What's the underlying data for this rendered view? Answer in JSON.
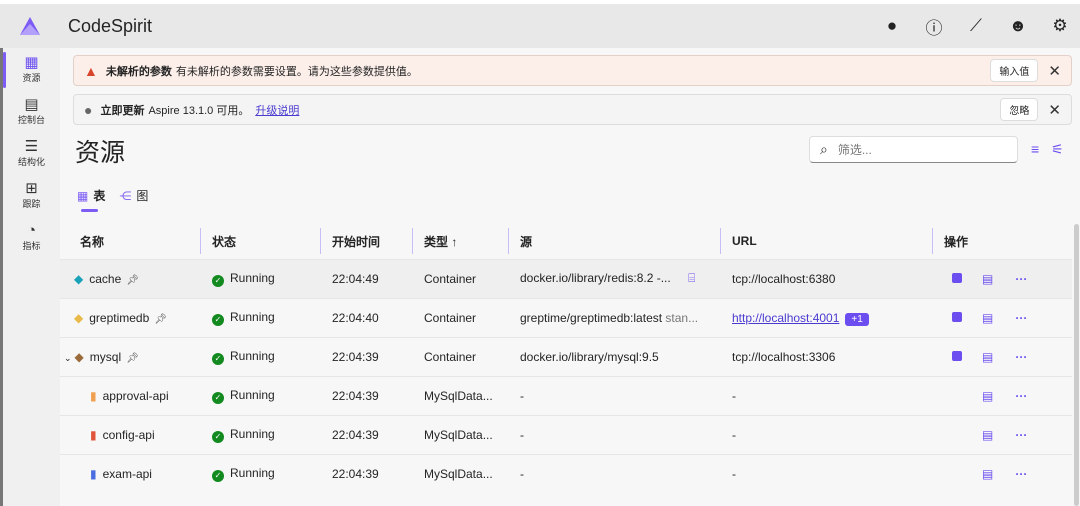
{
  "app": {
    "title": "CodeSpirit"
  },
  "sidebar": {
    "items": [
      {
        "label": "资源",
        "icon": "▦"
      },
      {
        "label": "控制台",
        "icon": "▤"
      },
      {
        "label": "结构化",
        "icon": "☰"
      },
      {
        "label": "跟踪",
        "icon": "⊞"
      },
      {
        "label": "指标",
        "icon": "◔"
      }
    ]
  },
  "banners": {
    "warning": {
      "title": "未解析的参数",
      "text": "有未解析的参数需要设置。请为这些参数提供值。",
      "button": "输入值"
    },
    "update": {
      "title": "立即更新",
      "text": "Aspire 13.1.0 可用。",
      "link": "升级说明",
      "button": "忽略"
    }
  },
  "page": {
    "title": "资源",
    "filter_placeholder": "筛选..."
  },
  "tabs": [
    {
      "label": "表"
    },
    {
      "label": "图"
    }
  ],
  "table": {
    "headers": [
      "名称",
      "状态",
      "开始时间",
      "类型 ↑",
      "源",
      "URL",
      "操作"
    ],
    "rows": [
      {
        "name": "cache",
        "icon": "◆",
        "icon_color": "#1aa3b8",
        "pinned": true,
        "status": "Running",
        "start": "22:04:49",
        "type": "Container",
        "source": "docker.io/library/redis:8.2 -...",
        "source_extra": "",
        "url": "tcp://localhost:6380",
        "url_link": false,
        "url_extra": "",
        "stop": true
      },
      {
        "name": "greptimedb",
        "icon": "◆",
        "icon_color": "#e9b94a",
        "pinned": true,
        "status": "Running",
        "start": "22:04:40",
        "type": "Container",
        "source": "greptime/greptimedb:latest",
        "source_extra": "stan...",
        "url": "http://localhost:4001",
        "url_link": true,
        "url_extra": "+1",
        "stop": true
      },
      {
        "name": "mysql",
        "icon": "◆",
        "icon_color": "#9a6a3a",
        "pinned": true,
        "status": "Running",
        "start": "22:04:39",
        "type": "Container",
        "source": "docker.io/library/mysql:9.5",
        "source_extra": "",
        "url": "tcp://localhost:3306",
        "url_link": false,
        "url_extra": "",
        "stop": true
      },
      {
        "name": "approval-api",
        "icon": "▮",
        "icon_color": "#f0a050",
        "pinned": false,
        "status": "Running",
        "start": "22:04:39",
        "type": "MySqlData...",
        "source": "-",
        "source_extra": "",
        "url": "-",
        "url_link": false,
        "url_extra": "",
        "stop": false
      },
      {
        "name": "config-api",
        "icon": "▮",
        "icon_color": "#e0553a",
        "pinned": false,
        "status": "Running",
        "start": "22:04:39",
        "type": "MySqlData...",
        "source": "-",
        "source_extra": "",
        "url": "-",
        "url_link": false,
        "url_extra": "",
        "stop": false
      },
      {
        "name": "exam-api",
        "icon": "▮",
        "icon_color": "#4a6ee0",
        "pinned": false,
        "status": "Running",
        "start": "22:04:39",
        "type": "MySqlData...",
        "source": "-",
        "source_extra": "",
        "url": "-",
        "url_link": false,
        "url_extra": "",
        "stop": false
      }
    ]
  },
  "colors": {
    "accent": "#6c4ef0",
    "running": "#138a1f"
  }
}
